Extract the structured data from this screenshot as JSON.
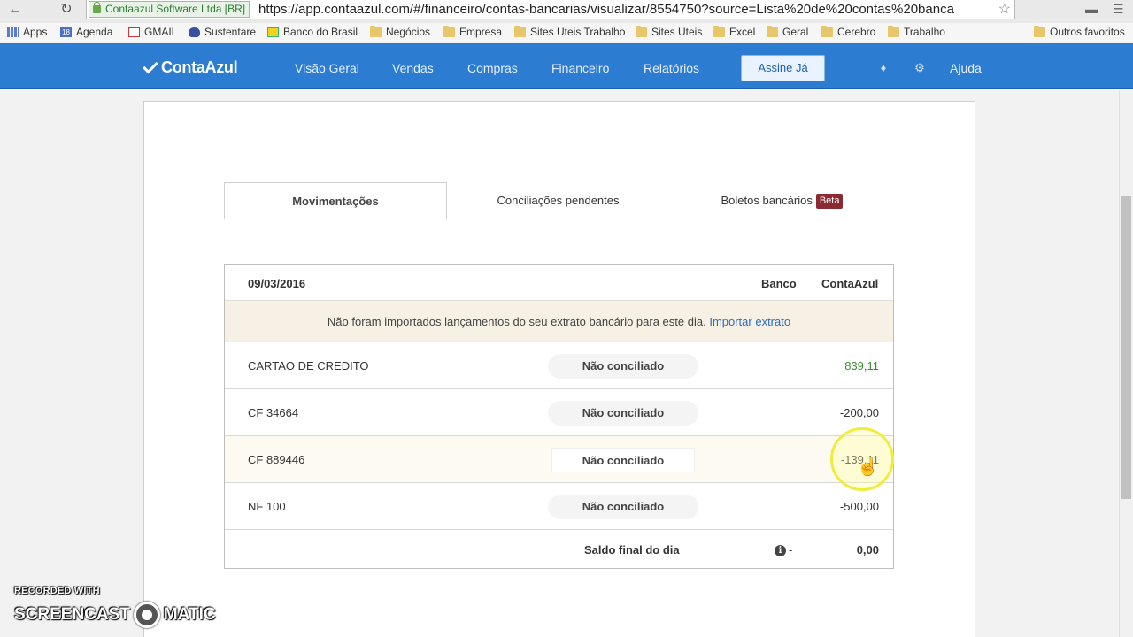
{
  "browser": {
    "secure_label": "Contaazul Software Ltda [BR]",
    "url": "https://app.contaazul.com/#/financeiro/contas-bancarias/visualizar/8554750?source=Lista%20de%20contas%20banca",
    "bookmarks": [
      "Apps",
      "Agenda",
      "GMAIL",
      "Sustentare",
      "Banco do Brasil",
      "Negócios",
      "Empresa",
      "Sites Uteis Trabalho",
      "Sites Uteis",
      "Excel",
      "Geral",
      "Cerebro",
      "Trabalho"
    ],
    "other_bookmarks": "Outros favoritos",
    "agenda_badge": "18"
  },
  "header": {
    "logo": "ContaAzul",
    "nav": [
      "Visão Geral",
      "Vendas",
      "Compras",
      "Financeiro",
      "Relatórios"
    ],
    "cta": "Assine Já",
    "help": "Ajuda"
  },
  "tabs": {
    "movimentacoes": "Movimentações",
    "conciliacoes": "Conciliações pendentes",
    "boletos": "Boletos bancários",
    "beta": "Beta"
  },
  "table": {
    "date": "09/03/2016",
    "col_banco": "Banco",
    "col_contaazul": "ContaAzul",
    "notice_text": "Não foram importados lançamentos do seu extrato bancário para este dia.",
    "notice_link": "Importar extrato",
    "rows": [
      {
        "name": "CARTAO DE CREDITO",
        "status": "Não conciliado",
        "amount": "839,11"
      },
      {
        "name": "CF 34664",
        "status": "Não conciliado",
        "amount": "-200,00"
      },
      {
        "name": "CF 889446",
        "status": "Não conciliado",
        "amount": "-139,11"
      },
      {
        "name": "NF 100",
        "status": "Não conciliado",
        "amount": "-500,00"
      }
    ],
    "total_label": "Saldo final do dia",
    "total_dash": "-",
    "total_amount": "0,00"
  },
  "watermark": {
    "small": "RECORDED WITH",
    "big_left": "SCREENCAST",
    "big_right": "MATIC"
  }
}
